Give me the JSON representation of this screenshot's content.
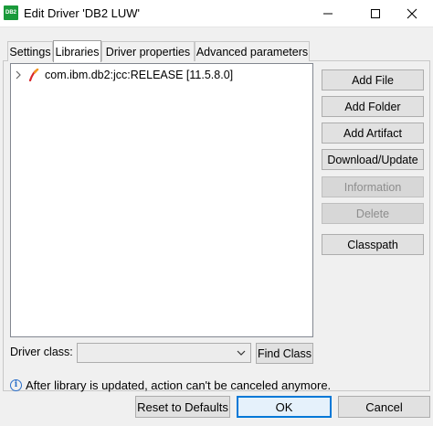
{
  "window": {
    "icon_text": "DB2",
    "title": "Edit Driver 'DB2 LUW'"
  },
  "tabs": [
    {
      "label": "Settings",
      "active": false
    },
    {
      "label": "Libraries",
      "active": true
    },
    {
      "label": "Driver properties",
      "active": false
    },
    {
      "label": "Advanced parameters",
      "active": false
    }
  ],
  "libraries": {
    "items": [
      {
        "label": "com.ibm.db2:jcc:RELEASE [11.5.8.0]",
        "icon": "maven-feather-icon",
        "expanded": false
      }
    ]
  },
  "buttons": {
    "add_file": "Add File",
    "add_folder": "Add Folder",
    "add_artifact": "Add Artifact",
    "download_update": "Download/Update",
    "information": "Information",
    "delete": "Delete",
    "classpath": "Classpath"
  },
  "driver_class": {
    "label": "Driver class:",
    "value": "",
    "find_class": "Find Class"
  },
  "info": {
    "message": "After library is updated, action can't be canceled anymore."
  },
  "dialog": {
    "reset": "Reset to Defaults",
    "ok": "OK",
    "cancel": "Cancel"
  },
  "colors": {
    "accent": "#0078d7",
    "icon_green": "#1a9a3a",
    "info_blue": "#2b6fc9"
  }
}
